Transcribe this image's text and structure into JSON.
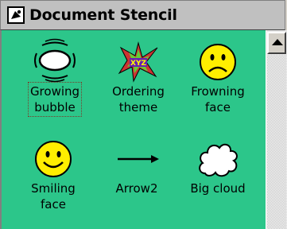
{
  "window": {
    "title": "Document Stencil"
  },
  "stencil": {
    "background": "#2cc68a",
    "items": [
      {
        "label_line1": "Growing",
        "label_line2": "bubble",
        "icon": "growing-bubble-icon",
        "selected": true
      },
      {
        "label_line1": "Ordering",
        "label_line2": "theme",
        "icon": "ordering-theme-icon",
        "badge": "XYZ"
      },
      {
        "label_line1": "Frowning",
        "label_line2": "face",
        "icon": "frowning-face-icon"
      },
      {
        "label_line1": "Smiling",
        "label_line2": "face",
        "icon": "smiling-face-icon"
      },
      {
        "label_line1": "Arrow2",
        "label_line2": "",
        "icon": "arrow-icon"
      },
      {
        "label_line1": "Big cloud",
        "label_line2": "",
        "icon": "cloud-icon"
      }
    ]
  }
}
